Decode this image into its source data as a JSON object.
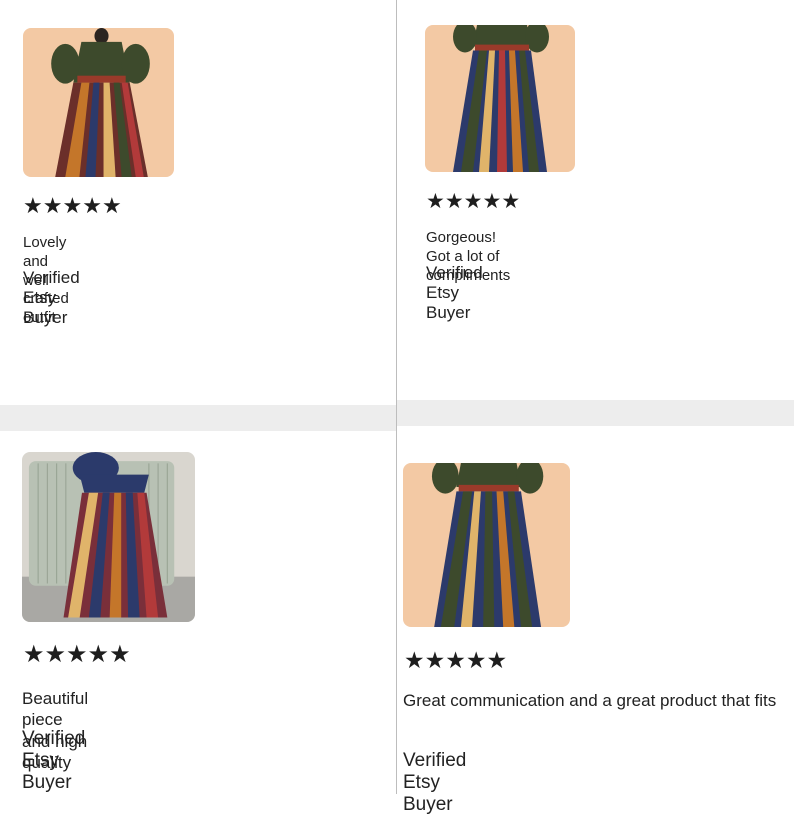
{
  "reviews": [
    {
      "rating": 5,
      "star_glyph": "★",
      "text": "Lovely and well crafted outfit",
      "buyer": "Verified Etsy Buyer",
      "photo": "green-patchwork-dress-peach-bg"
    },
    {
      "rating": 5,
      "star_glyph": "★",
      "text": "Gorgeous! Got a lot of compliments",
      "buyer": "Verified Etsy Buyer",
      "photo": "green-patchwork-skirt-peach-bg"
    },
    {
      "rating": 5,
      "star_glyph": "★",
      "text": "Beautiful piece and high quality",
      "buyer": "Verified Etsy Buyer",
      "photo": "navy-patchwork-dress-room-bg"
    },
    {
      "rating": 5,
      "star_glyph": "★",
      "text": "Great communication and a great product that fits",
      "buyer": "Verified Etsy Buyer",
      "photo": "green-patchwork-skirt-peach-bg"
    }
  ],
  "colors": {
    "star": "#1e1e1e",
    "text": "#222222",
    "divider": "#bdbdbd",
    "band": "#ededed",
    "peach": "#f3c9a4"
  }
}
